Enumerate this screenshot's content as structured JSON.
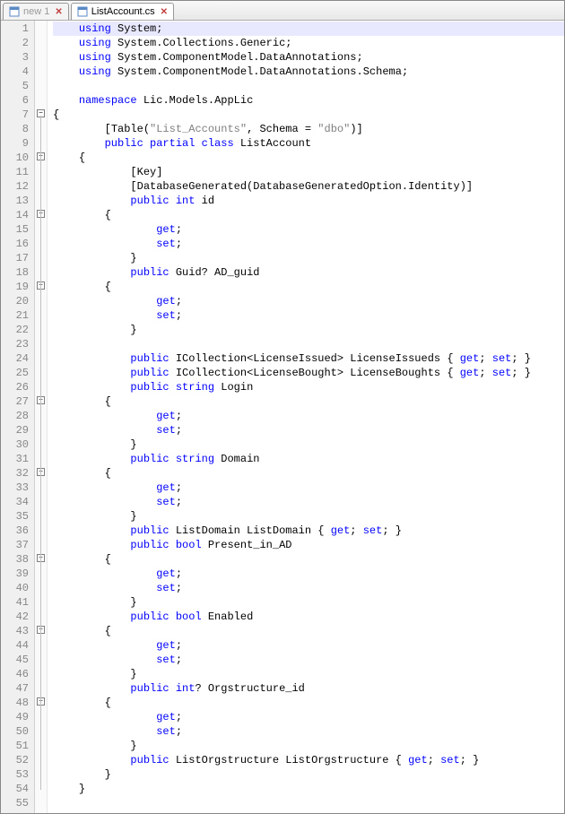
{
  "tabs": [
    {
      "label": "new 1",
      "active": false
    },
    {
      "label": "ListAccount.cs",
      "active": true
    }
  ],
  "code": {
    "lines": [
      {
        "n": 1,
        "i": 1,
        "t": [
          [
            "kw",
            "using"
          ],
          [
            "",
            ""
          ],
          [
            "id",
            " System"
          ],
          [
            "punc",
            ";"
          ]
        ]
      },
      {
        "n": 2,
        "i": 1,
        "t": [
          [
            "kw",
            "using"
          ],
          [
            "id",
            " System"
          ],
          [
            "punc",
            "."
          ],
          [
            "id",
            "Collections"
          ],
          [
            "punc",
            "."
          ],
          [
            "id",
            "Generic"
          ],
          [
            "punc",
            ";"
          ]
        ]
      },
      {
        "n": 3,
        "i": 1,
        "t": [
          [
            "kw",
            "using"
          ],
          [
            "id",
            " System"
          ],
          [
            "punc",
            "."
          ],
          [
            "id",
            "ComponentModel"
          ],
          [
            "punc",
            "."
          ],
          [
            "id",
            "DataAnnotations"
          ],
          [
            "punc",
            ";"
          ]
        ]
      },
      {
        "n": 4,
        "i": 1,
        "t": [
          [
            "kw",
            "using"
          ],
          [
            "id",
            " System"
          ],
          [
            "punc",
            "."
          ],
          [
            "id",
            "ComponentModel"
          ],
          [
            "punc",
            "."
          ],
          [
            "id",
            "DataAnnotations"
          ],
          [
            "punc",
            "."
          ],
          [
            "id",
            "Schema"
          ],
          [
            "punc",
            ";"
          ]
        ]
      },
      {
        "n": 5,
        "i": 1,
        "t": []
      },
      {
        "n": 6,
        "i": 1,
        "t": [
          [
            "kw",
            "namespace"
          ],
          [
            "id",
            " Lic"
          ],
          [
            "punc",
            "."
          ],
          [
            "id",
            "Models"
          ],
          [
            "punc",
            "."
          ],
          [
            "id",
            "AppLic"
          ]
        ]
      },
      {
        "n": 7,
        "i": 0,
        "fold": true,
        "t": [
          [
            "punc",
            "{"
          ]
        ]
      },
      {
        "n": 8,
        "i": 2,
        "t": [
          [
            "punc",
            "["
          ],
          [
            "id",
            "Table"
          ],
          [
            "punc",
            "("
          ],
          [
            "str",
            "\"List_Accounts\""
          ],
          [
            "punc",
            ", "
          ],
          [
            "id",
            "Schema"
          ],
          [
            "punc",
            " = "
          ],
          [
            "str",
            "\"dbo\""
          ],
          [
            "punc",
            ")]"
          ]
        ]
      },
      {
        "n": 9,
        "i": 2,
        "t": [
          [
            "kw",
            "public"
          ],
          [
            "kw",
            " partial"
          ],
          [
            "kw",
            " class"
          ],
          [
            "id",
            " ListAccount"
          ]
        ]
      },
      {
        "n": 10,
        "i": 1,
        "fold": true,
        "t": [
          [
            "punc",
            "{"
          ]
        ]
      },
      {
        "n": 11,
        "i": 3,
        "t": [
          [
            "punc",
            "["
          ],
          [
            "id",
            "Key"
          ],
          [
            "punc",
            "]"
          ]
        ]
      },
      {
        "n": 12,
        "i": 3,
        "t": [
          [
            "punc",
            "["
          ],
          [
            "id",
            "DatabaseGenerated"
          ],
          [
            "punc",
            "("
          ],
          [
            "id",
            "DatabaseGeneratedOption"
          ],
          [
            "punc",
            "."
          ],
          [
            "id",
            "Identity"
          ],
          [
            "punc",
            ")]"
          ]
        ]
      },
      {
        "n": 13,
        "i": 3,
        "t": [
          [
            "kw",
            "public"
          ],
          [
            "kw",
            " int"
          ],
          [
            "id",
            " id"
          ]
        ]
      },
      {
        "n": 14,
        "i": 2,
        "fold": true,
        "t": [
          [
            "punc",
            "{"
          ]
        ]
      },
      {
        "n": 15,
        "i": 4,
        "t": [
          [
            "kw",
            "get"
          ],
          [
            "punc",
            ";"
          ]
        ]
      },
      {
        "n": 16,
        "i": 4,
        "t": [
          [
            "kw",
            "set"
          ],
          [
            "punc",
            ";"
          ]
        ]
      },
      {
        "n": 17,
        "i": 3,
        "t": [
          [
            "punc",
            "}"
          ]
        ]
      },
      {
        "n": 18,
        "i": 3,
        "t": [
          [
            "kw",
            "public"
          ],
          [
            "id",
            " Guid"
          ],
          [
            "punc",
            "?"
          ],
          [
            "id",
            " AD_guid"
          ]
        ]
      },
      {
        "n": 19,
        "i": 2,
        "fold": true,
        "t": [
          [
            "punc",
            "{"
          ]
        ]
      },
      {
        "n": 20,
        "i": 4,
        "t": [
          [
            "kw",
            "get"
          ],
          [
            "punc",
            ";"
          ]
        ]
      },
      {
        "n": 21,
        "i": 4,
        "t": [
          [
            "kw",
            "set"
          ],
          [
            "punc",
            ";"
          ]
        ]
      },
      {
        "n": 22,
        "i": 3,
        "t": [
          [
            "punc",
            "}"
          ]
        ]
      },
      {
        "n": 23,
        "i": 3,
        "t": []
      },
      {
        "n": 24,
        "i": 3,
        "t": [
          [
            "kw",
            "public"
          ],
          [
            "id",
            " ICollection"
          ],
          [
            "punc",
            "<"
          ],
          [
            "id",
            "LicenseIssued"
          ],
          [
            "punc",
            ">"
          ],
          [
            "id",
            " LicenseIssueds"
          ],
          [
            "punc",
            " { "
          ],
          [
            "kw",
            "get"
          ],
          [
            "punc",
            "; "
          ],
          [
            "kw",
            "set"
          ],
          [
            "punc",
            "; }"
          ]
        ]
      },
      {
        "n": 25,
        "i": 3,
        "t": [
          [
            "kw",
            "public"
          ],
          [
            "id",
            " ICollection"
          ],
          [
            "punc",
            "<"
          ],
          [
            "id",
            "LicenseBought"
          ],
          [
            "punc",
            ">"
          ],
          [
            "id",
            " LicenseBoughts"
          ],
          [
            "punc",
            " { "
          ],
          [
            "kw",
            "get"
          ],
          [
            "punc",
            "; "
          ],
          [
            "kw",
            "set"
          ],
          [
            "punc",
            "; }"
          ]
        ]
      },
      {
        "n": 26,
        "i": 3,
        "t": [
          [
            "kw",
            "public"
          ],
          [
            "kw",
            " string"
          ],
          [
            "id",
            " Login"
          ]
        ]
      },
      {
        "n": 27,
        "i": 2,
        "fold": true,
        "t": [
          [
            "punc",
            "{"
          ]
        ]
      },
      {
        "n": 28,
        "i": 4,
        "t": [
          [
            "kw",
            "get"
          ],
          [
            "punc",
            ";"
          ]
        ]
      },
      {
        "n": 29,
        "i": 4,
        "t": [
          [
            "kw",
            "set"
          ],
          [
            "punc",
            ";"
          ]
        ]
      },
      {
        "n": 30,
        "i": 3,
        "t": [
          [
            "punc",
            "}"
          ]
        ]
      },
      {
        "n": 31,
        "i": 3,
        "t": [
          [
            "kw",
            "public"
          ],
          [
            "kw",
            " string"
          ],
          [
            "id",
            " Domain"
          ]
        ]
      },
      {
        "n": 32,
        "i": 2,
        "fold": true,
        "t": [
          [
            "punc",
            "{"
          ]
        ]
      },
      {
        "n": 33,
        "i": 4,
        "t": [
          [
            "kw",
            "get"
          ],
          [
            "punc",
            ";"
          ]
        ]
      },
      {
        "n": 34,
        "i": 4,
        "t": [
          [
            "kw",
            "set"
          ],
          [
            "punc",
            ";"
          ]
        ]
      },
      {
        "n": 35,
        "i": 3,
        "t": [
          [
            "punc",
            "}"
          ]
        ]
      },
      {
        "n": 36,
        "i": 3,
        "t": [
          [
            "kw",
            "public"
          ],
          [
            "id",
            " ListDomain"
          ],
          [
            "id",
            " ListDomain"
          ],
          [
            "punc",
            " { "
          ],
          [
            "kw",
            "get"
          ],
          [
            "punc",
            "; "
          ],
          [
            "kw",
            "set"
          ],
          [
            "punc",
            "; }"
          ]
        ]
      },
      {
        "n": 37,
        "i": 3,
        "t": [
          [
            "kw",
            "public"
          ],
          [
            "kw",
            " bool"
          ],
          [
            "id",
            " Present_in_AD"
          ]
        ]
      },
      {
        "n": 38,
        "i": 2,
        "fold": true,
        "t": [
          [
            "punc",
            "{"
          ]
        ]
      },
      {
        "n": 39,
        "i": 4,
        "t": [
          [
            "kw",
            "get"
          ],
          [
            "punc",
            ";"
          ]
        ]
      },
      {
        "n": 40,
        "i": 4,
        "t": [
          [
            "kw",
            "set"
          ],
          [
            "punc",
            ";"
          ]
        ]
      },
      {
        "n": 41,
        "i": 3,
        "t": [
          [
            "punc",
            "}"
          ]
        ]
      },
      {
        "n": 42,
        "i": 3,
        "t": [
          [
            "kw",
            "public"
          ],
          [
            "kw",
            " bool"
          ],
          [
            "id",
            " Enabled"
          ]
        ]
      },
      {
        "n": 43,
        "i": 2,
        "fold": true,
        "t": [
          [
            "punc",
            "{"
          ]
        ]
      },
      {
        "n": 44,
        "i": 4,
        "t": [
          [
            "kw",
            "get"
          ],
          [
            "punc",
            ";"
          ]
        ]
      },
      {
        "n": 45,
        "i": 4,
        "t": [
          [
            "kw",
            "set"
          ],
          [
            "punc",
            ";"
          ]
        ]
      },
      {
        "n": 46,
        "i": 3,
        "t": [
          [
            "punc",
            "}"
          ]
        ]
      },
      {
        "n": 47,
        "i": 3,
        "t": [
          [
            "kw",
            "public"
          ],
          [
            "kw",
            " int"
          ],
          [
            "punc",
            "?"
          ],
          [
            "id",
            " Orgstructure_id"
          ]
        ]
      },
      {
        "n": 48,
        "i": 2,
        "fold": true,
        "t": [
          [
            "punc",
            "{"
          ]
        ]
      },
      {
        "n": 49,
        "i": 4,
        "t": [
          [
            "kw",
            "get"
          ],
          [
            "punc",
            ";"
          ]
        ]
      },
      {
        "n": 50,
        "i": 4,
        "t": [
          [
            "kw",
            "set"
          ],
          [
            "punc",
            ";"
          ]
        ]
      },
      {
        "n": 51,
        "i": 3,
        "t": [
          [
            "punc",
            "}"
          ]
        ]
      },
      {
        "n": 52,
        "i": 3,
        "t": [
          [
            "kw",
            "public"
          ],
          [
            "id",
            " ListOrgstructure"
          ],
          [
            "id",
            " ListOrgstructure"
          ],
          [
            "punc",
            " { "
          ],
          [
            "kw",
            "get"
          ],
          [
            "punc",
            "; "
          ],
          [
            "kw",
            "set"
          ],
          [
            "punc",
            "; }"
          ]
        ]
      },
      {
        "n": 53,
        "i": 2,
        "t": [
          [
            "punc",
            "}"
          ]
        ]
      },
      {
        "n": 54,
        "i": 1,
        "t": [
          [
            "punc",
            "}"
          ]
        ]
      },
      {
        "n": 55,
        "i": 1,
        "t": []
      }
    ],
    "currentLine": 1
  }
}
